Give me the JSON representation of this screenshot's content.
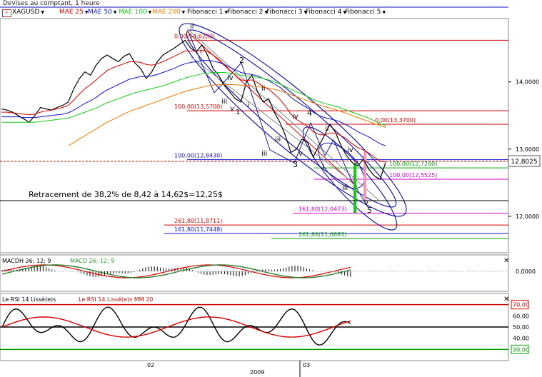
{
  "window": {
    "title": "Devises au comptant, 1 heure"
  },
  "toolbar": {
    "symbol": "XAGUSD",
    "items": [
      {
        "label": "MAE 25",
        "color": "#d40000"
      },
      {
        "label": "MAE 50",
        "color": "#1010c8"
      },
      {
        "label": "MAE 100",
        "color": "#18c818"
      },
      {
        "label": "MAE 200",
        "color": "#f07800"
      },
      {
        "label": "Fibonacci 1",
        "color": "#000000"
      },
      {
        "label": "Fibonacci 2",
        "color": "#000000"
      },
      {
        "label": "Fibonacci 3",
        "color": "#000000"
      },
      {
        "label": "Fibonacci 4",
        "color": "#000000"
      },
      {
        "label": "Fibonacci 5",
        "color": "#000000"
      }
    ]
  },
  "price_panel": {
    "current_price": "12,8025",
    "annotation": "Retracement de 38,2% de 8,42 à 14,62$=12,25$",
    "fib_labels": [
      {
        "text": "0,00(14,6200)",
        "price": 14.62,
        "color": "#d40000"
      },
      {
        "text": "100,00(13,5700)",
        "price": 13.57,
        "color": "#d40000"
      },
      {
        "text": "0,00(13,3700)",
        "price": 13.37,
        "color": "#d40000"
      },
      {
        "text": "100,00(12,8430)",
        "price": 12.843,
        "color": "#1010c8"
      },
      {
        "text": "100,00(12,7200)",
        "price": 12.72,
        "color": "#00a000"
      },
      {
        "text": "100,00(12,5525)",
        "price": 12.5525,
        "color": "#d000d0"
      },
      {
        "text": "161,80(12,0473)",
        "price": 12.0473,
        "color": "#d000d0"
      },
      {
        "text": "261,80(11,8711)",
        "price": 11.8711,
        "color": "#d40000"
      },
      {
        "text": "161,80(11,7448)",
        "price": 11.7448,
        "color": "#1010c8"
      },
      {
        "text": "261,80(11,6683)",
        "price": 11.6683,
        "color": "#00a000"
      }
    ],
    "wave_labels": [
      "ii",
      "i",
      "iii",
      "iv",
      "v",
      "1",
      "2",
      "i",
      "ii",
      "iii",
      "iii",
      "iv",
      "v",
      "3",
      "4",
      "i",
      "ii",
      "iii",
      "iv",
      "v",
      "5"
    ]
  },
  "macd_panel": {
    "title": "MACDH 26; 12; 9",
    "title2": "MACD 26; 12; 9",
    "axis_label": "0,0000"
  },
  "rsi_panel": {
    "title": "Le RSI 14 Lissé(e)s",
    "title2": "Le RSI 14 Lissé(e)s MM 20",
    "levels": [
      "70,00",
      "60,00",
      "50,00",
      "40,00",
      "30,00"
    ]
  },
  "time_axis": {
    "labels": [
      "02",
      "03"
    ],
    "year": "2009"
  },
  "chart_data": {
    "type": "line",
    "title": "XAGUSD",
    "y_axis_ticks": [
      "14,0000",
      "13,0000",
      "12,0000"
    ],
    "ylim": [
      11.5,
      14.9
    ],
    "series": [
      {
        "name": "XAGUSD",
        "color": "#000000",
        "values": [
          13.6,
          13.58,
          13.55,
          13.5,
          13.45,
          13.4,
          13.5,
          13.62,
          13.6,
          13.58,
          13.62,
          13.65,
          13.7,
          13.9,
          14.05,
          14.15,
          14.1,
          14.25,
          14.35,
          14.4,
          14.35,
          14.3,
          14.38,
          14.42,
          14.28,
          14.2,
          14.05,
          14.15,
          14.3,
          14.4,
          14.45,
          14.5,
          14.56,
          14.62,
          14.5,
          14.45,
          14.55,
          14.4,
          14.2,
          14.1,
          13.95,
          13.85,
          13.75,
          13.7,
          14.0,
          14.1,
          13.85,
          13.7,
          13.75,
          13.55,
          13.4,
          13.2,
          12.95,
          13.0,
          13.15,
          13.1,
          12.88,
          13.05,
          13.2,
          13.37,
          13.25,
          13.05,
          12.9,
          12.8,
          12.75,
          12.85,
          12.7,
          12.6,
          12.55,
          12.8
        ]
      },
      {
        "name": "MAE 25",
        "color": "#d40000",
        "values": [
          13.55,
          13.55,
          13.54,
          13.53,
          13.52,
          13.51,
          13.52,
          13.55,
          13.57,
          13.58,
          13.6,
          13.62,
          13.65,
          13.73,
          13.82,
          13.9,
          13.96,
          14.03,
          14.1,
          14.17,
          14.21,
          14.24,
          14.27,
          14.3,
          14.3,
          14.29,
          14.26,
          14.25,
          14.27,
          14.3,
          14.34,
          14.38,
          14.42,
          14.46,
          14.46,
          14.46,
          14.47,
          14.45,
          14.4,
          14.34,
          14.26,
          14.18,
          14.1,
          14.03,
          14.02,
          14.03,
          13.99,
          13.93,
          13.89,
          13.82,
          13.74,
          13.64,
          13.52,
          13.44,
          13.39,
          13.34,
          13.26,
          13.22,
          13.21,
          13.24,
          13.24,
          13.2,
          13.15,
          13.08,
          13.02,
          12.99,
          12.94,
          12.88,
          12.82,
          12.81
        ]
      },
      {
        "name": "MAE 50",
        "color": "#1010c8",
        "values": [
          13.48,
          13.48,
          13.48,
          13.48,
          13.47,
          13.47,
          13.47,
          13.48,
          13.49,
          13.5,
          13.51,
          13.52,
          13.54,
          13.58,
          13.63,
          13.68,
          13.72,
          13.77,
          13.83,
          13.88,
          13.92,
          13.96,
          14.0,
          14.04,
          14.06,
          14.08,
          14.08,
          14.09,
          14.11,
          14.14,
          14.17,
          14.2,
          14.24,
          14.27,
          14.29,
          14.3,
          14.32,
          14.32,
          14.31,
          14.29,
          14.26,
          14.22,
          14.18,
          14.14,
          14.12,
          14.11,
          14.09,
          14.05,
          14.02,
          13.97,
          13.92,
          13.85,
          13.77,
          13.71,
          13.66,
          13.61,
          13.55,
          13.5,
          13.47,
          13.45,
          13.43,
          13.4,
          13.36,
          13.31,
          13.26,
          13.22,
          13.18,
          13.13,
          13.08,
          13.05
        ]
      },
      {
        "name": "MAE 100",
        "color": "#18c818",
        "values": [
          13.4,
          13.4,
          13.4,
          13.4,
          13.4,
          13.4,
          13.4,
          13.41,
          13.42,
          13.43,
          13.44,
          13.45,
          13.46,
          13.49,
          13.52,
          13.55,
          13.58,
          13.61,
          13.65,
          13.69,
          13.72,
          13.75,
          13.78,
          13.81,
          13.84,
          13.86,
          13.88,
          13.9,
          13.92,
          13.94,
          13.97,
          14.0,
          14.03,
          14.06,
          14.08,
          14.1,
          14.12,
          14.13,
          14.14,
          14.14,
          14.14,
          14.13,
          14.12,
          14.1,
          14.09,
          14.08,
          14.07,
          14.05,
          14.03,
          14.0,
          13.97,
          13.93,
          13.89,
          13.85,
          13.82,
          13.78,
          13.74,
          13.71,
          13.68,
          13.66,
          13.64,
          13.61,
          13.58,
          13.55,
          13.52,
          13.49,
          13.46,
          13.42,
          13.38,
          13.35
        ]
      },
      {
        "name": "MAE 200",
        "color": "#f07800",
        "values": [
          null,
          null,
          null,
          null,
          null,
          null,
          null,
          null,
          null,
          null,
          null,
          null,
          13.05,
          13.1,
          13.15,
          13.2,
          13.25,
          13.3,
          13.35,
          13.4,
          13.44,
          13.48,
          13.52,
          13.56,
          13.59,
          13.62,
          13.65,
          13.68,
          13.71,
          13.74,
          13.77,
          13.8,
          13.83,
          13.86,
          13.88,
          13.9,
          13.92,
          13.94,
          13.95,
          13.96,
          13.96,
          13.96,
          13.96,
          13.95,
          13.95,
          13.94,
          13.93,
          13.92,
          13.91,
          13.89,
          13.87,
          13.84,
          13.81,
          13.78,
          13.75,
          13.72,
          13.69,
          13.66,
          13.63,
          13.61,
          13.59,
          13.56,
          13.53,
          13.5,
          13.47,
          13.44,
          13.41,
          13.38,
          13.35,
          13.32
        ]
      }
    ]
  }
}
